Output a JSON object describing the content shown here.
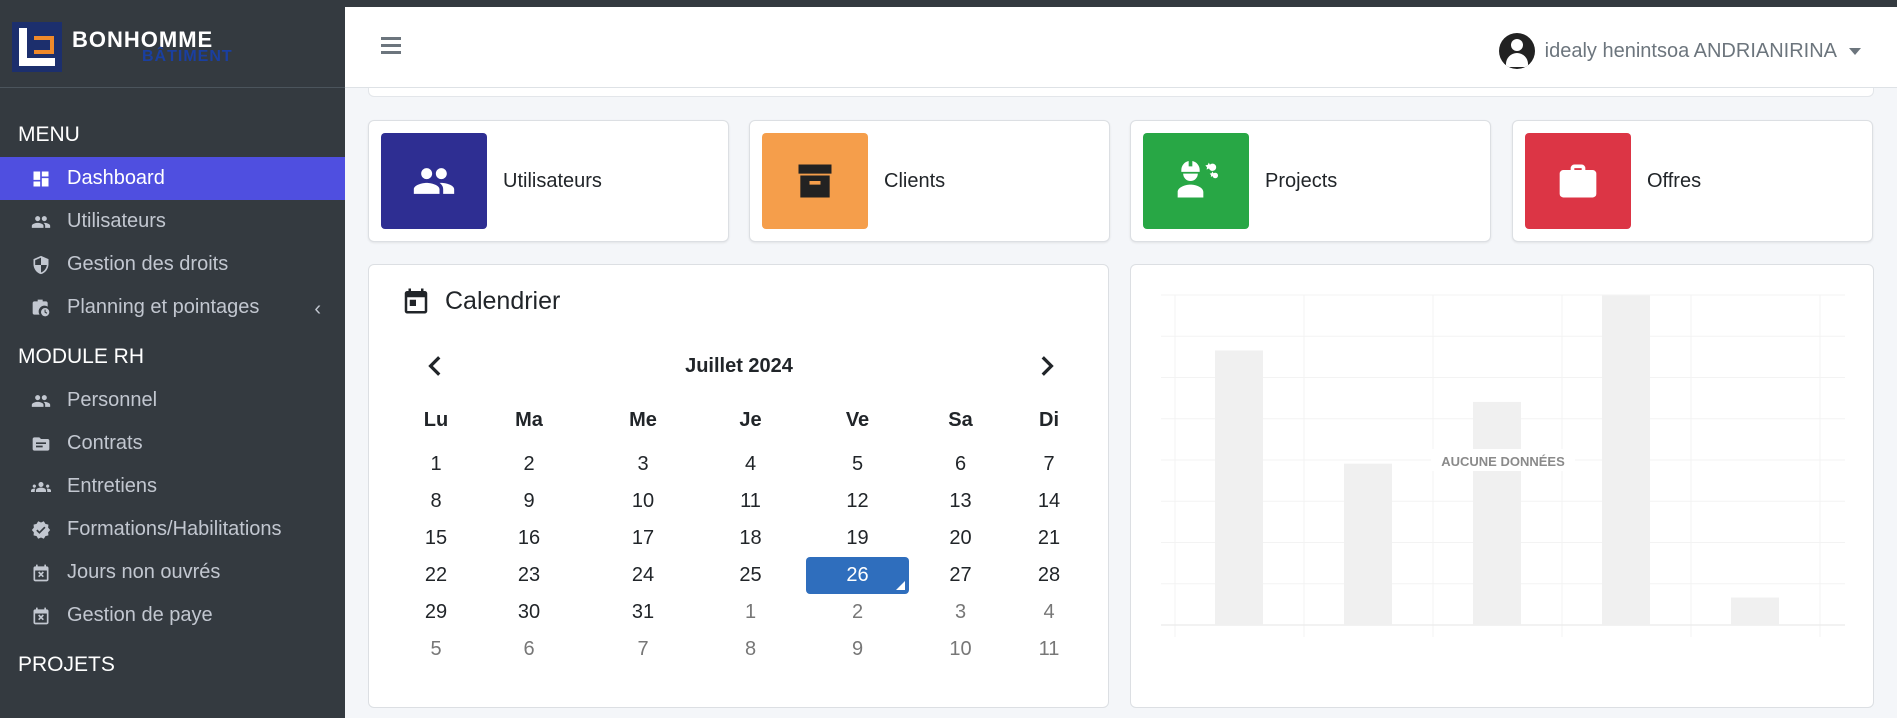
{
  "brand": {
    "name": "BONHOMME",
    "sub": "BÂTIMENT"
  },
  "sidebar": {
    "sections": [
      {
        "header": "MENU",
        "items": [
          {
            "label": "Dashboard",
            "icon": "dashboard-icon",
            "active": true
          },
          {
            "label": "Utilisateurs",
            "icon": "users-icon"
          },
          {
            "label": "Gestion des droits",
            "icon": "shield-icon"
          },
          {
            "label": "Planning et pointages",
            "icon": "briefcase-clock-icon",
            "expandable": true
          }
        ]
      },
      {
        "header": "MODULE RH",
        "items": [
          {
            "label": "Personnel",
            "icon": "users-icon"
          },
          {
            "label": "Contrats",
            "icon": "folder-icon"
          },
          {
            "label": "Entretiens",
            "icon": "group-icon"
          },
          {
            "label": "Formations/Habilitations",
            "icon": "verified-icon"
          },
          {
            "label": "Jours non ouvrés",
            "icon": "calendar-x-icon"
          },
          {
            "label": "Gestion de paye",
            "icon": "calendar-x-icon"
          }
        ]
      },
      {
        "header": "PROJETS",
        "items": []
      }
    ],
    "expand_arrow": "‹"
  },
  "header": {
    "user_name": "idealy henintsoa ANDRIANIRINA"
  },
  "info_boxes": [
    {
      "label": "Utilisateurs",
      "color": "#2e2e92",
      "icon": "users-icon"
    },
    {
      "label": "Clients",
      "color": "#f59e4b",
      "icon": "archive-icon"
    },
    {
      "label": "Projects",
      "color": "#28a745",
      "icon": "engineer-icon"
    },
    {
      "label": "Offres",
      "color": "#dc3545",
      "icon": "briefcase-icon"
    }
  ],
  "calendar": {
    "title": "Calendrier",
    "month_label": "Juillet 2024",
    "weekdays": [
      "Lu",
      "Ma",
      "Me",
      "Je",
      "Ve",
      "Sa",
      "Di"
    ],
    "weeks": [
      [
        {
          "d": "1"
        },
        {
          "d": "2"
        },
        {
          "d": "3"
        },
        {
          "d": "4"
        },
        {
          "d": "5"
        },
        {
          "d": "6"
        },
        {
          "d": "7"
        }
      ],
      [
        {
          "d": "8"
        },
        {
          "d": "9"
        },
        {
          "d": "10"
        },
        {
          "d": "11"
        },
        {
          "d": "12"
        },
        {
          "d": "13"
        },
        {
          "d": "14"
        }
      ],
      [
        {
          "d": "15"
        },
        {
          "d": "16"
        },
        {
          "d": "17"
        },
        {
          "d": "18"
        },
        {
          "d": "19"
        },
        {
          "d": "20"
        },
        {
          "d": "21"
        }
      ],
      [
        {
          "d": "22"
        },
        {
          "d": "23"
        },
        {
          "d": "24"
        },
        {
          "d": "25"
        },
        {
          "d": "26",
          "today": true
        },
        {
          "d": "27"
        },
        {
          "d": "28"
        }
      ],
      [
        {
          "d": "29"
        },
        {
          "d": "30"
        },
        {
          "d": "31"
        },
        {
          "d": "1",
          "other": true
        },
        {
          "d": "2",
          "other": true
        },
        {
          "d": "3",
          "other": true
        },
        {
          "d": "4",
          "other": true
        }
      ],
      [
        {
          "d": "5",
          "other": true
        },
        {
          "d": "6",
          "other": true
        },
        {
          "d": "7",
          "other": true
        },
        {
          "d": "8",
          "other": true
        },
        {
          "d": "9",
          "other": true
        },
        {
          "d": "10",
          "other": true
        },
        {
          "d": "11",
          "other": true
        }
      ]
    ]
  },
  "chart": {
    "no_data_label": "AUCUNE DONNÉES",
    "placeholder_bars": [
      0.8,
      0.47,
      0.65,
      0.96,
      0.08
    ]
  }
}
